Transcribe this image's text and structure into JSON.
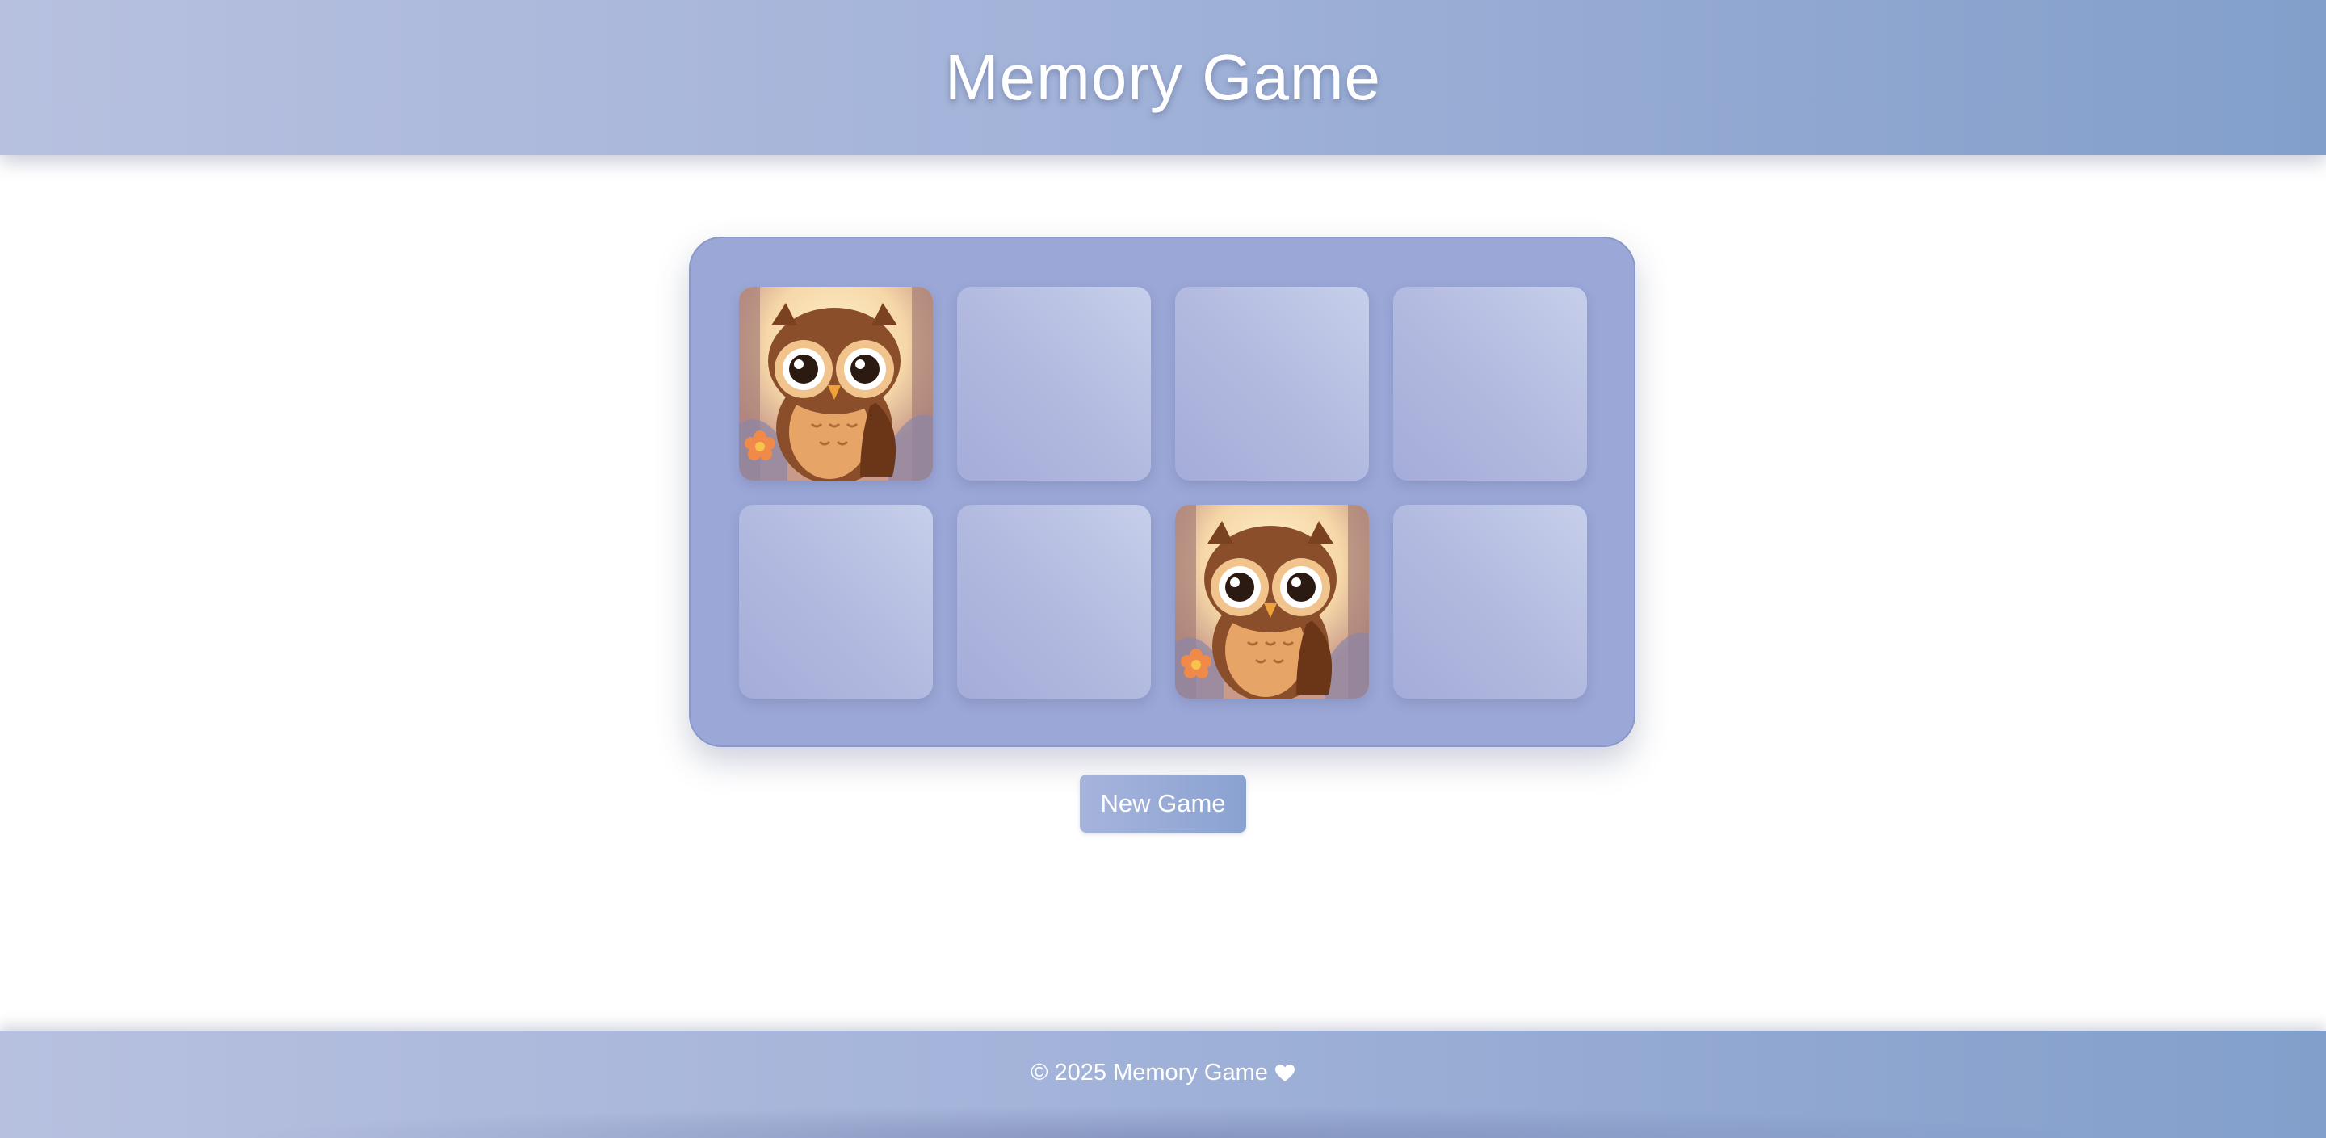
{
  "header": {
    "title": "Memory Game"
  },
  "board": {
    "rows": 2,
    "columns": 4,
    "cards": [
      {
        "state": "face-up",
        "image": "owl"
      },
      {
        "state": "face-down"
      },
      {
        "state": "face-down"
      },
      {
        "state": "face-down"
      },
      {
        "state": "face-down"
      },
      {
        "state": "face-down"
      },
      {
        "state": "face-up",
        "image": "owl"
      },
      {
        "state": "face-down"
      }
    ]
  },
  "controls": {
    "new_game_label": "New Game"
  },
  "footer": {
    "text": "© 2025 Memory Game",
    "icon": "heart-icon"
  },
  "colors": {
    "header_gradient_start": "#b7c0df",
    "header_gradient_end": "#829fcb",
    "board_background": "#9ba7d6",
    "card_back": "#b3bae0",
    "text": "#ffffff"
  }
}
